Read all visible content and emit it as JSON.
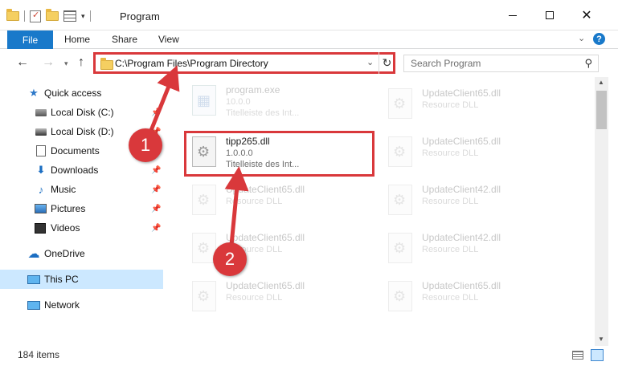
{
  "window": {
    "title": "Program",
    "buttons": {
      "minimize": "",
      "maximize": "",
      "close": "✕"
    }
  },
  "ribbon": {
    "tabs": {
      "file": "File",
      "home": "Home",
      "share": "Share",
      "view": "View"
    },
    "help": "?"
  },
  "address": {
    "path": "C:\\Program Files\\Program Directory",
    "search_placeholder": "Search Program"
  },
  "sidebar": {
    "items": [
      {
        "label": "Quick access",
        "icon": "star-icon"
      },
      {
        "label": "Local Disk (C:)",
        "icon": "disk-icon"
      },
      {
        "label": "Local Disk (D:)",
        "icon": "disk-icon"
      },
      {
        "label": "Documents",
        "icon": "documents-icon"
      },
      {
        "label": "Downloads",
        "icon": "download-icon"
      },
      {
        "label": "Music",
        "icon": "music-icon"
      },
      {
        "label": "Pictures",
        "icon": "pictures-icon"
      },
      {
        "label": "Videos",
        "icon": "videos-icon"
      },
      {
        "label": "OneDrive",
        "icon": "cloud-icon"
      },
      {
        "label": "This PC",
        "icon": "computer-icon"
      },
      {
        "label": "Network",
        "icon": "network-icon"
      }
    ]
  },
  "files": {
    "col1": [
      {
        "name": "program.exe",
        "line1": "10.0.0",
        "line2": "Titelleiste des Int..."
      },
      {
        "name": "tipp265.dll",
        "line1": "1.0.0.0",
        "line2": "Titelleiste des Int..."
      },
      {
        "name": "UpdateClient65.dll",
        "line1": "Resource DLL"
      },
      {
        "name": "UpdateClient65.dll",
        "line1": "Resource DLL"
      },
      {
        "name": "UpdateClient65.dll",
        "line1": "Resource DLL"
      }
    ],
    "col2": [
      {
        "name": "UpdateClient65.dll",
        "line1": "Resource DLL"
      },
      {
        "name": "UpdateClient65.dll",
        "line1": "Resource DLL"
      },
      {
        "name": "UpdateClient42.dll",
        "line1": "Resource DLL"
      },
      {
        "name": "UpdateClient42.dll",
        "line1": "Resource DLL"
      },
      {
        "name": "UpdateClient65.dll",
        "line1": "Resource DLL"
      }
    ]
  },
  "status": {
    "item_count": "184 items"
  },
  "annotations": {
    "step1": "1",
    "step2": "2"
  },
  "colors": {
    "accent": "#1979ca",
    "highlight": "#d9383b",
    "selection": "#cce8ff"
  }
}
